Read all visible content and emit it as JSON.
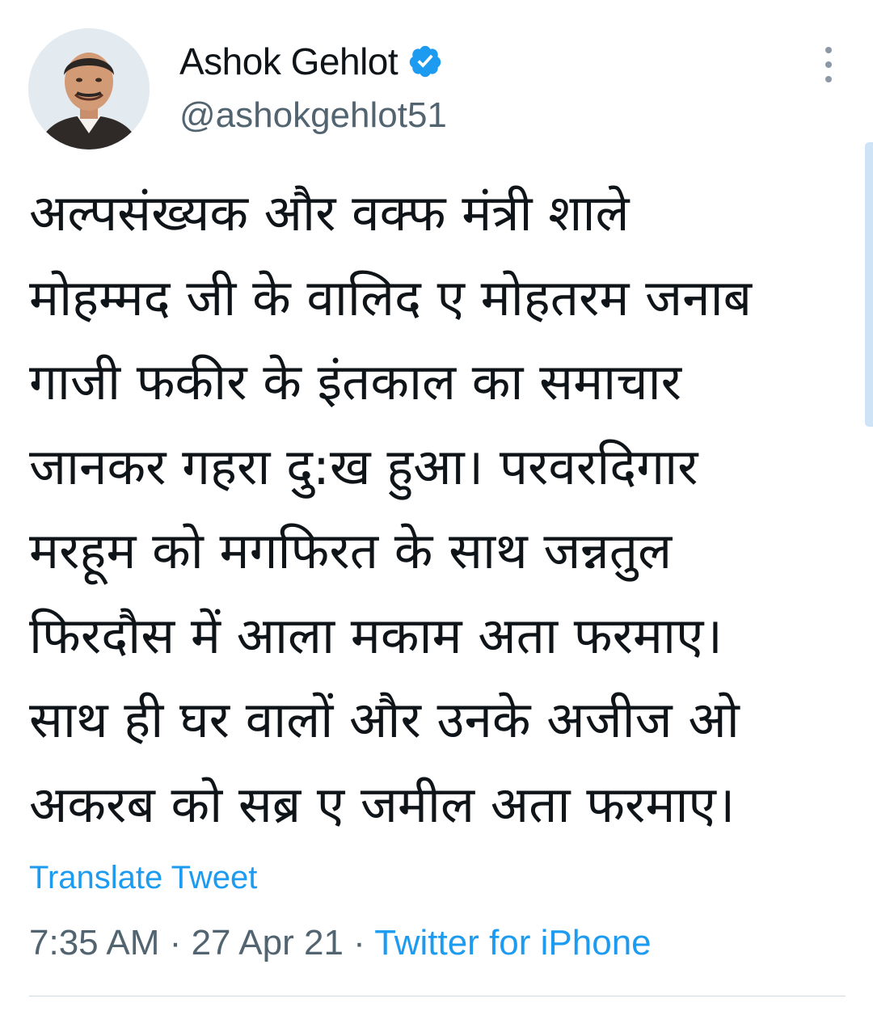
{
  "tweet": {
    "author": {
      "display_name": "Ashok Gehlot",
      "handle": "@ashokgehlot51",
      "verified": true
    },
    "text_lines": [
      "अल्पसंख्यक और वक्फ मंत्री शाले",
      "मोहम्मद जी के वालिद ए मोहतरम जनाब",
      "गाजी फकीर के इंतकाल का समाचार",
      "जानकर गहरा दु:ख हुआ। परवरदिगार",
      "मरहूम को मगफिरत के साथ जन्नतुल",
      "फिरदौस में आला मकाम अता फरमाए।",
      "साथ ही घर वालों और उनके अजीज ओ",
      "अकरब को सब्र ए जमील अता फरमाए।"
    ],
    "translate_label": "Translate Tweet",
    "time": "7:35 AM",
    "date": "27 Apr 21",
    "separator": "·",
    "source": "Twitter for iPhone"
  },
  "colors": {
    "text_primary": "#0f1419",
    "text_secondary": "#536471",
    "accent": "#1d9bf0",
    "divider": "#cfd9de"
  },
  "icons": {
    "verified": "verified-badge-icon",
    "more": "more-options-icon"
  }
}
